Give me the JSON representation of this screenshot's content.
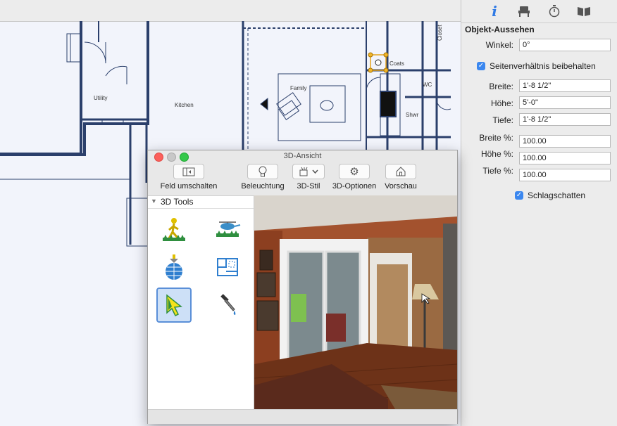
{
  "plan": {
    "rooms": {
      "utility": "Utility",
      "kitchen": "Kitchen",
      "family": "Family",
      "coats": "Coats",
      "wc": "WC",
      "shwr": "Shwr",
      "closet": "Closet"
    }
  },
  "inspector": {
    "tabs": [
      "info-icon",
      "chair-icon",
      "timer-icon",
      "book-icon"
    ],
    "section_title": "Objekt-Aussehen",
    "angle_label": "Winkel:",
    "angle_value": "0°",
    "keep_ratio_label": "Seitenverhältnis beibehalten",
    "width_label": "Breite:",
    "width_value": "1'-8 1/2\"",
    "height_label": "Höhe:",
    "height_value": "5'-0\"",
    "depth_label": "Tiefe:",
    "depth_value": "1'-8 1/2\"",
    "width_pct_label": "Breite %:",
    "width_pct_value": "100.00",
    "height_pct_label": "Höhe %:",
    "height_pct_value": "100.00",
    "depth_pct_label": "Tiefe %:",
    "depth_pct_value": "100.00",
    "shadow_label": "Schlagschatten",
    "accent": "#3b87ef"
  },
  "window3d": {
    "title": "3D-Ansicht",
    "toolbar": {
      "toggle_label": "Feld umschalten",
      "lighting_label": "Beleuchtung",
      "style_label": "3D-Stil",
      "options_label": "3D-Optionen",
      "preview_label": "Vorschau"
    },
    "tools_title": "3D Tools",
    "tools": [
      "walk-tool-icon",
      "flyover-tool-icon",
      "orbit-tool-icon",
      "floorplan-tool-icon",
      "select-tool-icon",
      "eyedropper-tool-icon"
    ]
  }
}
